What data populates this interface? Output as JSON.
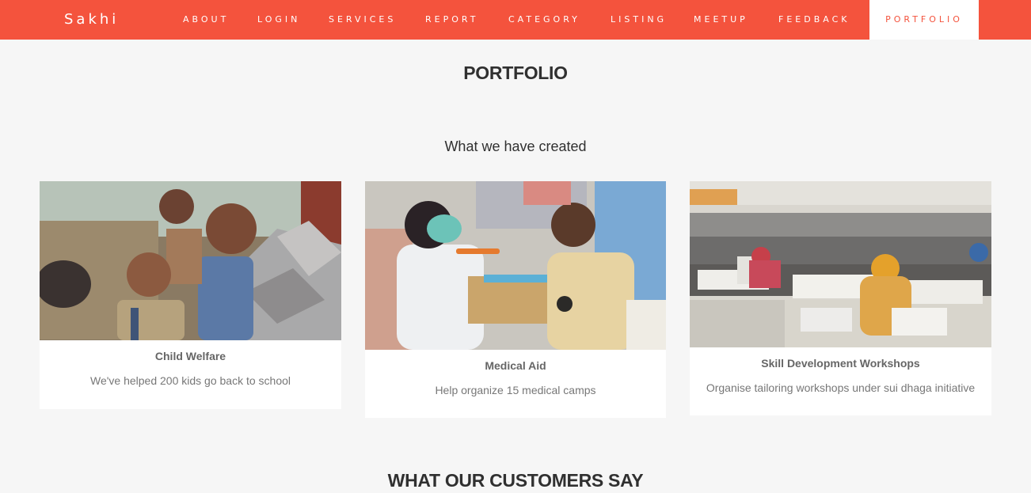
{
  "nav": {
    "brand": "Sakhi",
    "items": [
      {
        "label": "ABOUT"
      },
      {
        "label": "LOGIN"
      },
      {
        "label": "SERVICES"
      },
      {
        "label": "REPORT"
      },
      {
        "label": "CATEGORY"
      },
      {
        "label": "LISTING"
      },
      {
        "label": "MEETUP"
      },
      {
        "label": "FEEDBACK"
      },
      {
        "label": "PORTFOLIO"
      }
    ],
    "active": "PORTFOLIO"
  },
  "portfolio": {
    "heading": "PORTFOLIO",
    "subtitle": "What we have created",
    "cards": [
      {
        "title": "Child Welfare",
        "description": "We've helped 200 kids go back to school",
        "image": "children-photo"
      },
      {
        "title": "Medical Aid",
        "description": "Help organize 15 medical camps",
        "image": "medical-camp-photo"
      },
      {
        "title": "Skill Development Workshops",
        "description": "Organise tailoring workshops under sui dhaga initiative",
        "image": "tailoring-workshop-photo"
      }
    ]
  },
  "testimonials": {
    "heading": "WHAT OUR CUSTOMERS SAY"
  },
  "colors": {
    "brand": "#f4533d",
    "background": "#f6f6f6"
  }
}
